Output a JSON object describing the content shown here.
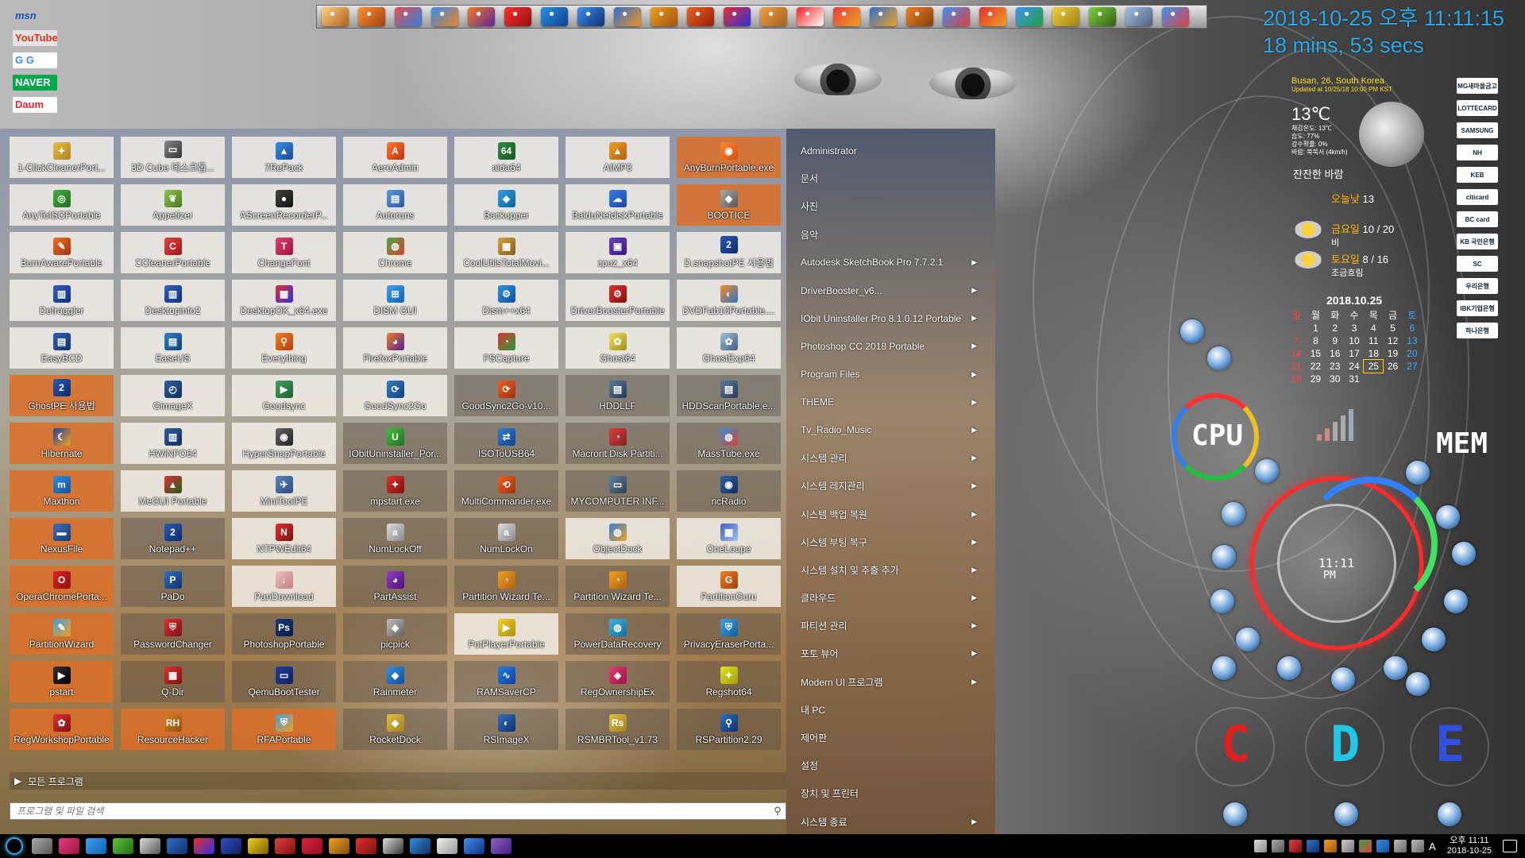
{
  "quicklinks": [
    "msn",
    "YouTube",
    "G G",
    "NAVER",
    "Daum"
  ],
  "clock": {
    "date_time": "2018-10-25 오후 11:11:15",
    "uptime": "18 mins, 53 secs"
  },
  "weather": {
    "location": "Busan, 26, South Korea",
    "updated": "Updated at 10/25/18 10:00 PM KST",
    "temperature": "13℃",
    "details": [
      "체감온도: 13℃",
      "습도: 77%",
      "강수확률: 0%",
      "바람: 북북서 (4km/h)"
    ],
    "condition": "잔잔한 바람",
    "today_label": "오늘낮",
    "today_value": "13",
    "day1_label": "금요일",
    "day1_value": "10 / 20",
    "day1_cond": "비",
    "day2_label": "토요일",
    "day2_value": "8 / 16",
    "day2_cond": "조금흐림"
  },
  "calendar": {
    "title": "2018.10.25",
    "weekdays": [
      "일",
      "월",
      "화",
      "수",
      "목",
      "금",
      "토"
    ],
    "weeks": [
      [
        "",
        "1",
        "2",
        "3",
        "4",
        "5",
        "6"
      ],
      [
        "7",
        "8",
        "9",
        "10",
        "11",
        "12",
        "13"
      ],
      [
        "14",
        "15",
        "16",
        "17",
        "18",
        "19",
        "20"
      ],
      [
        "21",
        "22",
        "23",
        "24",
        "25",
        "26",
        "27"
      ],
      [
        "28",
        "29",
        "30",
        "31",
        "",
        "",
        ""
      ]
    ],
    "today": "25"
  },
  "banks": [
    "MG새마을금고",
    "LOTTECARD",
    "SAMSUNG",
    "NH",
    "KEB",
    "citicard",
    "BC card",
    "KB 국민은행",
    "SC",
    "우리은행",
    "IBK기업은행",
    "하나은행"
  ],
  "hud": {
    "cpu_label": "CPU",
    "mem_label": "MEM",
    "time": "11:11",
    "ampm": "PM",
    "drives": [
      "C",
      "D",
      "E"
    ]
  },
  "tiles": [
    {
      "label": "1-ClickCleanerPort...",
      "icon": "broom-icon",
      "c1": "#e8c040",
      "c2": "#b08020",
      "g": "✦"
    },
    {
      "label": "3D Cube 데스크톱...",
      "icon": "monitor-icon",
      "c1": "#888888",
      "c2": "#333333",
      "g": "▭"
    },
    {
      "label": "7RePack",
      "icon": "triangle-icon",
      "c1": "#3a8ee8",
      "c2": "#1a4a9a",
      "g": "▲"
    },
    {
      "label": "AeroAdmin",
      "icon": "aeroadmin-icon",
      "c1": "#ff7a30",
      "c2": "#c03010",
      "g": "A"
    },
    {
      "label": "aida64",
      "icon": "aida64-icon",
      "c1": "#2e8b3e",
      "c2": "#1a5a25",
      "g": "64"
    },
    {
      "label": "AIMP3",
      "icon": "aimp-icon",
      "c1": "#f0a020",
      "c2": "#b06010",
      "g": "▲"
    },
    {
      "label": "AnyBurnPortable.exe",
      "icon": "disc-icon",
      "c1": "#ff8a30",
      "c2": "#d05010",
      "g": "◉",
      "style": "orange"
    },
    {
      "label": "AnyToISOPortable",
      "icon": "iso-icon",
      "c1": "#40b040",
      "c2": "#207020",
      "g": "◎"
    },
    {
      "label": "Appetizer",
      "icon": "appetizer-icon",
      "c1": "#8bc34a",
      "c2": "#4a7a20",
      "g": "❦"
    },
    {
      "label": "AScreenRecorderP...",
      "icon": "recorder-icon",
      "c1": "#444444",
      "c2": "#111111",
      "g": "●"
    },
    {
      "label": "Autoruns",
      "icon": "autoruns-icon",
      "c1": "#5a9ae0",
      "c2": "#2a5aa0",
      "g": "▤"
    },
    {
      "label": "Backupper",
      "icon": "backupper-icon",
      "c1": "#30a0e0",
      "c2": "#1060a0",
      "g": "◈"
    },
    {
      "label": "BalduNetdiskPortable",
      "icon": "cloud-icon",
      "c1": "#3a7ae8",
      "c2": "#1a4aa0",
      "g": "☁"
    },
    {
      "label": "BOOTICE",
      "icon": "bootice-icon",
      "c1": "#aaaaaa",
      "c2": "#555555",
      "g": "◆",
      "style": "orange"
    },
    {
      "label": "BurnAwarePortable",
      "icon": "burnaware-icon",
      "c1": "#f07020",
      "c2": "#a03010",
      "g": "✎"
    },
    {
      "label": "CCleanerPortable",
      "icon": "ccleaner-icon",
      "c1": "#e84040",
      "c2": "#a01818",
      "g": "C"
    },
    {
      "label": "ChangeFont",
      "icon": "font-icon",
      "c1": "#e04070",
      "c2": "#a01040",
      "g": "T"
    },
    {
      "label": "Chrome",
      "icon": "chrome-icon",
      "c1": "#4aa84a",
      "c2": "#d84030",
      "g": "◍"
    },
    {
      "label": "CoolUtilsTotalMovi...",
      "icon": "movie-icon",
      "c1": "#d8a040",
      "c2": "#806020",
      "g": "▦"
    },
    {
      "label": "cpuz_x64",
      "icon": "cpuz-icon",
      "c1": "#6a40c0",
      "c2": "#3a1a80",
      "g": "▣"
    },
    {
      "label": "D.snapshotPE 사용법",
      "icon": "snapshot-icon",
      "c1": "#2a5ab0",
      "c2": "#102a70",
      "g": "2"
    },
    {
      "label": "Defraggler",
      "icon": "defrag-icon",
      "c1": "#3060c0",
      "c2": "#103080",
      "g": "▥"
    },
    {
      "label": "Desktopinfo2",
      "icon": "desktopinfo-icon",
      "c1": "#3060c0",
      "c2": "#103080",
      "g": "▥"
    },
    {
      "label": "DesktopOK_x64.exe",
      "icon": "desktopok-icon",
      "c1": "#e03030",
      "c2": "#3030e0",
      "g": "▦"
    },
    {
      "label": "DISM GUI",
      "icon": "windows-icon",
      "c1": "#40a0f0",
      "c2": "#1060b0",
      "g": "⊞"
    },
    {
      "label": "Dism++x64",
      "icon": "dism-icon",
      "c1": "#3090e0",
      "c2": "#1050a0",
      "g": "⚙"
    },
    {
      "label": "DriverBoosterPortable",
      "icon": "driverbooster-icon",
      "c1": "#e03030",
      "c2": "#801010",
      "g": "⚙"
    },
    {
      "label": "DVDFab10Portable....",
      "icon": "dvdfab-icon",
      "c1": "#f09020",
      "c2": "#3070d0",
      "g": "◐"
    },
    {
      "label": "EasyBCD",
      "icon": "easybcd-icon",
      "c1": "#3060b0",
      "c2": "#103070",
      "g": "▤"
    },
    {
      "label": "EaseUS",
      "icon": "easeus-icon",
      "c1": "#3080c0",
      "c2": "#104080",
      "g": "▤"
    },
    {
      "label": "Everything",
      "icon": "magnifier-icon",
      "c1": "#f08020",
      "c2": "#b04010",
      "g": "⚲"
    },
    {
      "label": "FirefoxPortable",
      "icon": "firefox-icon",
      "c1": "#f08020",
      "c2": "#5020a0",
      "g": "◕"
    },
    {
      "label": "FSCapture",
      "icon": "fscapture-icon",
      "c1": "#e03030",
      "c2": "#20a040",
      "g": "◔"
    },
    {
      "label": "Ghost64",
      "icon": "ghost-icon",
      "c1": "#f0e060",
      "c2": "#a09020",
      "g": "✿"
    },
    {
      "label": "GhostExp64",
      "icon": "ghostexp-icon",
      "c1": "#a0c0e0",
      "c2": "#406080",
      "g": "✿"
    },
    {
      "label": "GhostPE 사용법",
      "icon": "ghostpe-icon",
      "c1": "#2a5ab0",
      "c2": "#102a70",
      "g": "2",
      "style": "orange"
    },
    {
      "label": "GimageX",
      "icon": "gimagex-icon",
      "c1": "#3060a0",
      "c2": "#103060",
      "g": "◴"
    },
    {
      "label": "Goodsync",
      "icon": "goodsync-icon",
      "c1": "#40a060",
      "c2": "#206030",
      "g": "▶"
    },
    {
      "label": "GoodSync2Go",
      "icon": "sync-icon",
      "c1": "#3080c0",
      "c2": "#104080",
      "g": "⟳"
    },
    {
      "label": "GoodSync2Go-v10...",
      "icon": "goodsync2go-icon",
      "c1": "#f06020",
      "c2": "#a03010",
      "g": "⟳",
      "style": "dark"
    },
    {
      "label": "HDDLLF",
      "icon": "hddllf-icon",
      "c1": "#5a7a9a",
      "c2": "#2a3a5a",
      "g": "▤",
      "style": "dark"
    },
    {
      "label": "HDDScanPortable.e...",
      "icon": "hddscan-icon",
      "c1": "#5a7a9a",
      "c2": "#2a3a5a",
      "g": "▤",
      "style": "dark"
    },
    {
      "label": "Hibernate",
      "icon": "hibernate-icon",
      "c1": "#2040a0",
      "c2": "#f0a020",
      "g": "☾",
      "style": "orange"
    },
    {
      "label": "HWiNFO64",
      "icon": "hwinfo-icon",
      "c1": "#3060a0",
      "c2": "#103060",
      "g": "▥"
    },
    {
      "label": "HyperSnapPortable",
      "icon": "camera-icon",
      "c1": "#666666",
      "c2": "#222222",
      "g": "◉"
    },
    {
      "label": "IObitUninstaller_Por...",
      "icon": "iobit-icon",
      "c1": "#40c040",
      "c2": "#207020",
      "g": "U",
      "style": "dark"
    },
    {
      "label": "ISOToUSB64",
      "icon": "usb-icon",
      "c1": "#3080d0",
      "c2": "#104090",
      "g": "⇄",
      "style": "dark"
    },
    {
      "label": "Macrorit Disk Partiti...",
      "icon": "macrorit-icon",
      "c1": "#e04040",
      "c2": "#802020",
      "g": "◔",
      "style": "dark"
    },
    {
      "label": "MassTube.exe",
      "icon": "masstube-icon",
      "c1": "#3090e0",
      "c2": "#e04030",
      "g": "◍",
      "style": "dark"
    },
    {
      "label": "Maxthon",
      "icon": "maxthon-icon",
      "c1": "#2a90e0",
      "c2": "#1050a0",
      "g": "m",
      "style": "orange"
    },
    {
      "label": "MeGUI Portable",
      "icon": "megui-icon",
      "c1": "#e03030",
      "c2": "#206020",
      "g": "▲"
    },
    {
      "label": "MiniToolPE",
      "icon": "minitool-icon",
      "c1": "#5a8ac0",
      "c2": "#2a4a80",
      "g": "✈"
    },
    {
      "label": "mpstart.exe",
      "icon": "mpstart-icon",
      "c1": "#e03030",
      "c2": "#801010",
      "g": "✦",
      "style": "dark"
    },
    {
      "label": "MultiCommander.exe",
      "icon": "multicommander-icon",
      "c1": "#f06020",
      "c2": "#a03010",
      "g": "⟲",
      "style": "dark"
    },
    {
      "label": "MYCOMPUTER INF...",
      "icon": "mycomputer-icon",
      "c1": "#6080a0",
      "c2": "#304050",
      "g": "▭",
      "style": "dark"
    },
    {
      "label": "ncRadio",
      "icon": "radio-icon",
      "c1": "#3060a0",
      "c2": "#103060",
      "g": "◉",
      "style": "dark"
    },
    {
      "label": "NexusFile",
      "icon": "folder-icon",
      "c1": "#3a70c0",
      "c2": "#1a3a70",
      "g": "▬",
      "style": "orange"
    },
    {
      "label": "Notepad++",
      "icon": "notepad-icon",
      "c1": "#2a5ab0",
      "c2": "#102a70",
      "g": "2",
      "style": "dark"
    },
    {
      "label": "NTPWEdit64",
      "icon": "ntpwedit-icon",
      "c1": "#e03030",
      "c2": "#801010",
      "g": "N"
    },
    {
      "label": "NumLockOff",
      "icon": "numlock-off-icon",
      "c1": "#dddddd",
      "c2": "#888888",
      "g": "a",
      "style": "dark"
    },
    {
      "label": "NumLockOn",
      "icon": "numlock-on-icon",
      "c1": "#dddddd",
      "c2": "#888888",
      "g": "a",
      "style": "dark"
    },
    {
      "label": "ObjectDock",
      "icon": "objectdock-icon",
      "c1": "#3080e0",
      "c2": "#f0a020",
      "g": "◍"
    },
    {
      "label": "OneLoupe",
      "icon": "loupe-icon",
      "c1": "#4060c0",
      "c2": "#a0c0f0",
      "g": "▦"
    },
    {
      "label": "OperaChromePorta...",
      "icon": "opera-icon",
      "c1": "#e02020",
      "c2": "#901010",
      "g": "O",
      "style": "orange"
    },
    {
      "label": "PaDo",
      "icon": "pado-icon",
      "c1": "#3070c0",
      "c2": "#103070",
      "g": "P",
      "style": "dark"
    },
    {
      "label": "PanDownload",
      "icon": "pandownload-icon",
      "c1": "#f0c0c0",
      "c2": "#c08080",
      "g": "↓"
    },
    {
      "label": "PartAssist",
      "icon": "partassist-icon",
      "c1": "#9040c0",
      "c2": "#501080",
      "g": "◕",
      "style": "dark"
    },
    {
      "label": "Partition Wizard Te...",
      "icon": "partition-wizard-icon",
      "c1": "#f0a020",
      "c2": "#b06010",
      "g": "◔",
      "style": "dark"
    },
    {
      "label": "Partition Wizard Te...",
      "icon": "partition-wizard2-icon",
      "c1": "#f0a020",
      "c2": "#b06010",
      "g": "◔",
      "style": "dark"
    },
    {
      "label": "PartitionGuru",
      "icon": "partitionguru-icon",
      "c1": "#f08020",
      "c2": "#a04010",
      "g": "G"
    },
    {
      "label": "PartitionWizard",
      "icon": "partitionwizard-icon",
      "c1": "#40a0e0",
      "c2": "#f0a020",
      "g": "✎",
      "style": "orange"
    },
    {
      "label": "PasswordChanger",
      "icon": "password-icon",
      "c1": "#e03030",
      "c2": "#801010",
      "g": "⛨",
      "style": "dark"
    },
    {
      "label": "PhotoshopPortable",
      "icon": "photoshop-icon",
      "c1": "#1a3a7a",
      "c2": "#0a1a4a",
      "g": "Ps",
      "style": "dark"
    },
    {
      "label": "picpick",
      "icon": "picpick-icon",
      "c1": "#c0c0c0",
      "c2": "#606060",
      "g": "◈",
      "style": "dark"
    },
    {
      "label": "PotPlayerPortable",
      "icon": "potplayer-icon",
      "c1": "#f0d020",
      "c2": "#b09010",
      "g": "▶"
    },
    {
      "label": "PowerDataRecovery",
      "icon": "recovery-icon",
      "c1": "#40b0e0",
      "c2": "#1070a0",
      "g": "◍",
      "style": "dark"
    },
    {
      "label": "PrivacyEraserPorta...",
      "icon": "privacy-icon",
      "c1": "#40a0e0",
      "c2": "#1060a0",
      "g": "⛨",
      "style": "dark"
    },
    {
      "label": "pstart",
      "icon": "pstart-icon",
      "c1": "#333333",
      "c2": "#000000",
      "g": "▶",
      "style": "orange"
    },
    {
      "label": "Q-Dir",
      "icon": "qdir-icon",
      "c1": "#e03030",
      "c2": "#801010",
      "g": "▦",
      "style": "dark"
    },
    {
      "label": "QemuBootTester",
      "icon": "qemu-icon",
      "c1": "#2040a0",
      "c2": "#102060",
      "g": "▭",
      "style": "dark"
    },
    {
      "label": "Rainmeter",
      "icon": "rainmeter-icon",
      "c1": "#3090e0",
      "c2": "#1050a0",
      "g": "◆",
      "style": "dark"
    },
    {
      "label": "RAMSaverCP",
      "icon": "ramsaver-icon",
      "c1": "#2080e0",
      "c2": "#1040a0",
      "g": "∿",
      "style": "dark"
    },
    {
      "label": "RegOwnershipEx",
      "icon": "regownership-icon",
      "c1": "#e04070",
      "c2": "#a01040",
      "g": "◈",
      "style": "dark"
    },
    {
      "label": "Regshot64",
      "icon": "regshot-icon",
      "c1": "#e0e020",
      "c2": "#a0a010",
      "g": "✦",
      "style": "dark"
    },
    {
      "label": "RegWorkshopPortable",
      "icon": "regworkshop-icon",
      "c1": "#e03030",
      "c2": "#801010",
      "g": "✿",
      "style": "orange"
    },
    {
      "label": "ResourceHacker",
      "icon": "resourcehacker-icon",
      "c1": "#d08020",
      "c2": "#905010",
      "g": "RH",
      "style": "orange"
    },
    {
      "label": "RFAPortable",
      "icon": "rfa-icon",
      "c1": "#40a0e0",
      "c2": "#f0a020",
      "g": "⛨",
      "style": "orange"
    },
    {
      "label": "RocketDock",
      "icon": "rocketdock-icon",
      "c1": "#e0c040",
      "c2": "#a08020",
      "g": "◆",
      "style": "dark"
    },
    {
      "label": "RSImageX",
      "icon": "rsimagex-icon",
      "c1": "#3070c0",
      "c2": "#103070",
      "g": "◐",
      "style": "dark"
    },
    {
      "label": "RSMBRTool_v1.73",
      "icon": "rsmbr-icon",
      "c1": "#e0c040",
      "c2": "#a08020",
      "g": "Rs",
      "style": "dark"
    },
    {
      "label": "RSPartition2.29",
      "icon": "rspartition-icon",
      "c1": "#3070c0",
      "c2": "#103070",
      "g": "⚲",
      "style": "dark"
    }
  ],
  "right_menu": [
    {
      "label": "Administrator",
      "arrow": false
    },
    {
      "label": "문서",
      "arrow": false
    },
    {
      "label": "사진",
      "arrow": false
    },
    {
      "label": "음악",
      "arrow": false
    },
    {
      "label": "Autodesk SketchBook Pro 7.7.2.1",
      "arrow": true
    },
    {
      "label": "DriverBooster_v6...",
      "arrow": true
    },
    {
      "label": "IObit Uninstaller Pro 8.1.0.12 Portable",
      "arrow": true
    },
    {
      "label": "Photoshop CC 2018 Portable",
      "arrow": true
    },
    {
      "label": "Program Files",
      "arrow": true
    },
    {
      "label": "THEME",
      "arrow": true
    },
    {
      "label": "Tv_Radio_Music",
      "arrow": true
    },
    {
      "label": "시스템 관리",
      "arrow": true
    },
    {
      "label": "시스템 레지관리",
      "arrow": true
    },
    {
      "label": "시스템 백업 복원",
      "arrow": true
    },
    {
      "label": "시스템 부팅 복구",
      "arrow": true
    },
    {
      "label": "시스템 설치 및 추출 추가",
      "arrow": true
    },
    {
      "label": "클라우드",
      "arrow": true
    },
    {
      "label": "파티션 관리",
      "arrow": true
    },
    {
      "label": "포토 뷰어",
      "arrow": true
    },
    {
      "label": "Modern UI 프로그램",
      "arrow": true
    },
    {
      "label": "내 PC",
      "arrow": false
    },
    {
      "label": "제어판",
      "arrow": false
    },
    {
      "label": "설정",
      "arrow": false
    },
    {
      "label": "장치 및 프린터",
      "arrow": false
    },
    {
      "label": "시스템 종료",
      "arrow": true
    }
  ],
  "all_programs": "모든 프로그램",
  "search": {
    "placeholder": "프로그램 및 파일 검색"
  },
  "tray": {
    "time": "오후 11:11",
    "date": "2018-10-25",
    "lang": "A"
  },
  "colors": {
    "clock": "#2aa9e8",
    "cpu_ring": "#ff3030",
    "mem_ring": "#ff2a2a",
    "drive_c": "#e02020",
    "drive_d": "#20c8e8",
    "drive_e": "#3050e0"
  }
}
